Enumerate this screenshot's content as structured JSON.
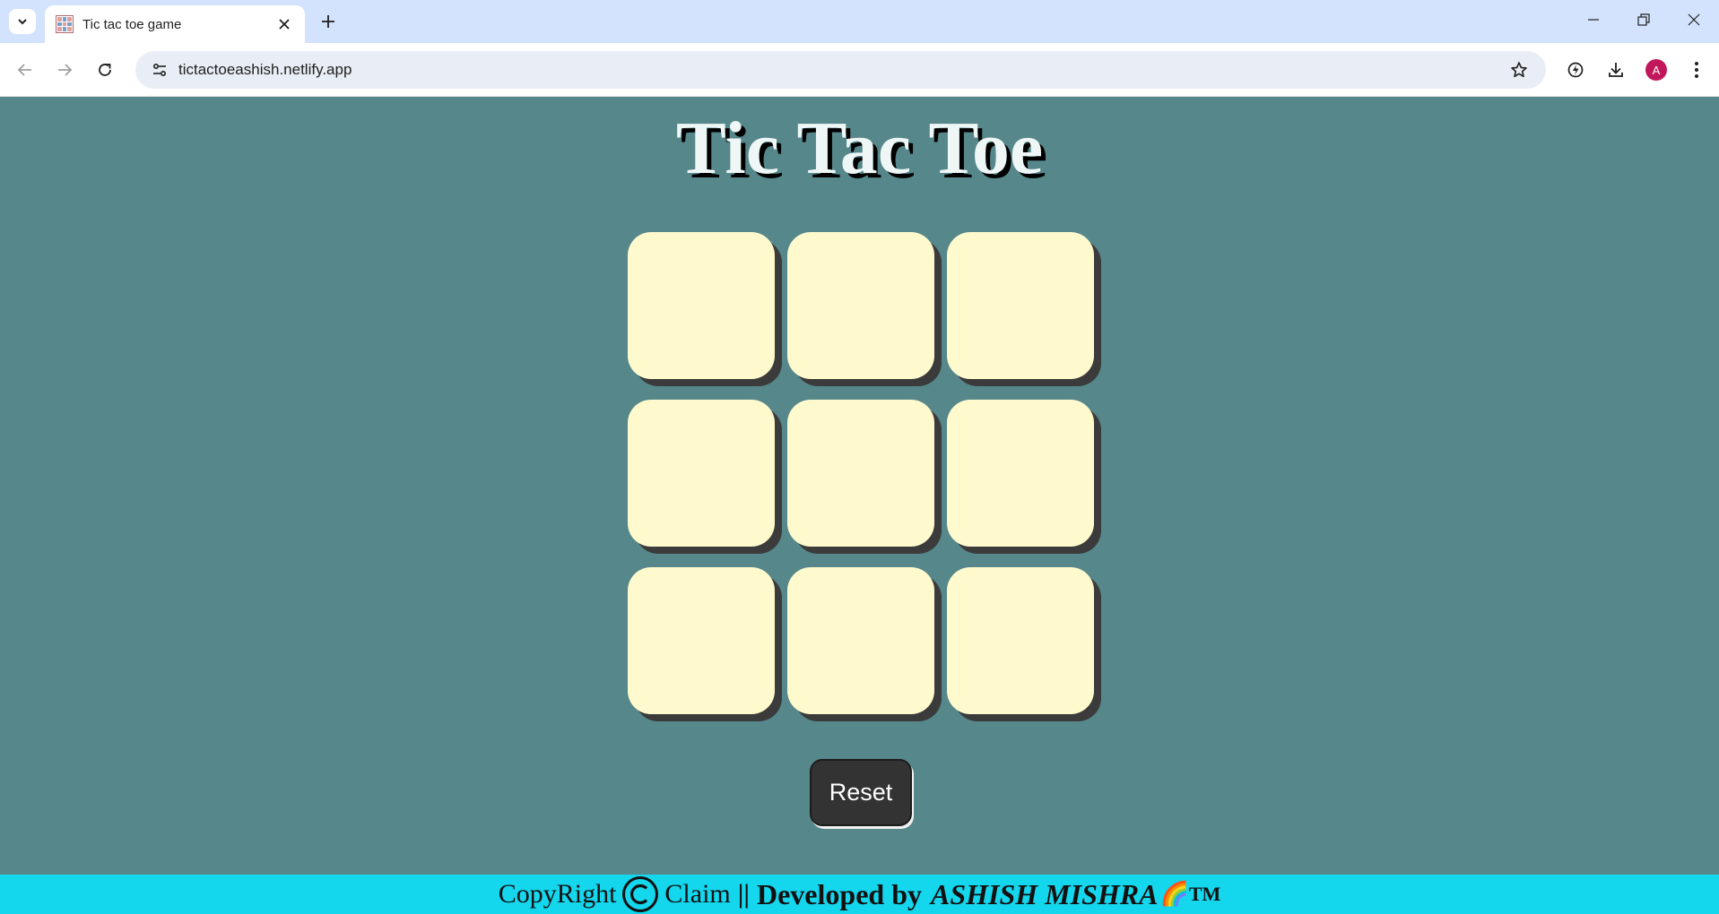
{
  "browser": {
    "tab": {
      "title": "Tic tac toe game"
    },
    "address_bar": {
      "url": "tictactoeashish.netlify.app"
    },
    "profile_initial": "A",
    "colors": {
      "tabbar": "#d3e3fd",
      "avatar": "#c2185b"
    },
    "icons": [
      "tab-search-icon",
      "close-icon",
      "plus-icon",
      "minimize-icon",
      "restore-icon",
      "window-close-icon",
      "back-arrow-icon",
      "forward-arrow-icon",
      "reload-icon",
      "site-info-icon",
      "star-icon",
      "performance-icon",
      "download-icon",
      "kebab-menu-icon"
    ]
  },
  "game": {
    "title": "Tic Tac Toe",
    "board": [
      "",
      "",
      "",
      "",
      "",
      "",
      "",
      "",
      ""
    ],
    "reset_label": "Reset",
    "colors": {
      "background": "#56878a",
      "cell": "#fffacd",
      "cell_shadow": "#3b3b3b",
      "reset_button": "#333333"
    }
  },
  "footer": {
    "copyright": "CopyRight",
    "claim": "Claim",
    "separator": "||",
    "developed_by": "Developed by",
    "author": "ASHISH MISHRA",
    "emoji": "🌈",
    "trademark": "TM",
    "colors": {
      "background": "#14d6ed"
    },
    "icons": [
      "copyright-icon"
    ]
  }
}
